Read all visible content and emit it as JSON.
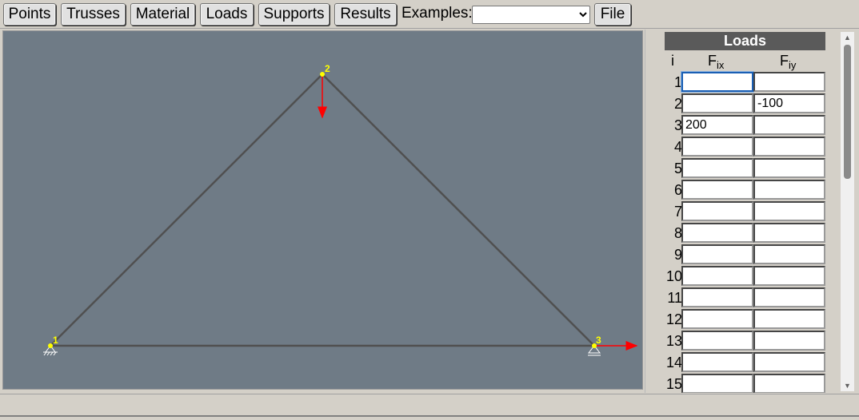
{
  "toolbar": {
    "buttons": [
      "Points",
      "Trusses",
      "Material",
      "Loads",
      "Supports",
      "Results"
    ],
    "examples_label": "Examples:",
    "examples_value": "",
    "file_label": "File"
  },
  "canvas": {
    "background": "#6f7b86",
    "nodes": [
      {
        "id": "1",
        "support": "fixed-pin"
      },
      {
        "id": "2",
        "support": "none"
      },
      {
        "id": "3",
        "support": "roller"
      }
    ],
    "members": [
      [
        "1",
        "2"
      ],
      [
        "2",
        "3"
      ],
      [
        "1",
        "3"
      ]
    ],
    "load_color": "#ff0000",
    "node_color": "#ffff00"
  },
  "loads_panel": {
    "title": "Loads",
    "col_i": "i",
    "col_fx": "F",
    "col_fx_sub": "ix",
    "col_fy": "F",
    "col_fy_sub": "iy",
    "rows": [
      {
        "i": "1",
        "fx": "",
        "fy": ""
      },
      {
        "i": "2",
        "fx": "",
        "fy": "-100"
      },
      {
        "i": "3",
        "fx": "200",
        "fy": ""
      },
      {
        "i": "4",
        "fx": "",
        "fy": ""
      },
      {
        "i": "5",
        "fx": "",
        "fy": ""
      },
      {
        "i": "6",
        "fx": "",
        "fy": ""
      },
      {
        "i": "7",
        "fx": "",
        "fy": ""
      },
      {
        "i": "8",
        "fx": "",
        "fy": ""
      },
      {
        "i": "9",
        "fx": "",
        "fy": ""
      },
      {
        "i": "10",
        "fx": "",
        "fy": ""
      },
      {
        "i": "11",
        "fx": "",
        "fy": ""
      },
      {
        "i": "12",
        "fx": "",
        "fy": ""
      },
      {
        "i": "13",
        "fx": "",
        "fy": ""
      },
      {
        "i": "14",
        "fx": "",
        "fy": ""
      },
      {
        "i": "15",
        "fx": "",
        "fy": ""
      }
    ]
  },
  "statusbar": {
    "text": ""
  }
}
